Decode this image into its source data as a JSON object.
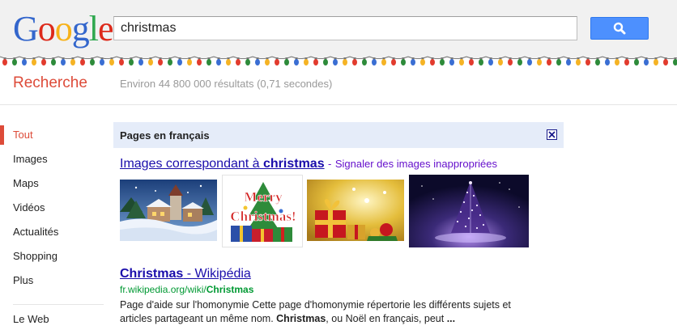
{
  "logo": {
    "letters": [
      "G",
      "o",
      "o",
      "g",
      "l",
      "e"
    ]
  },
  "search": {
    "query": "christmas"
  },
  "subheader": {
    "title": "Recherche",
    "stats": "Environ 44 800 000 résultats (0,71 secondes)"
  },
  "nav": {
    "items": [
      "Tout",
      "Images",
      "Maps",
      "Vidéos",
      "Actualités",
      "Shopping",
      "Plus"
    ],
    "web_label": "Le Web"
  },
  "lang_bar": {
    "title": "Pages en français"
  },
  "images": {
    "heading_prefix": "Images correspondant à ",
    "heading_query": "christmas",
    "report_link": "Signaler des images inappropriées"
  },
  "result": {
    "title_main": "Christmas",
    "title_suffix": " - Wikipédia",
    "url_prefix": "fr.wikipedia.org/wiki/",
    "url_bold": "Christmas",
    "snippet_line1": "Page d'aide sur l'homonymie Cette page d'homonymie répertorie les différents sujets et",
    "snippet_line2_a": "articles partageant un même nom. ",
    "snippet_line2_bold": "Christmas",
    "snippet_line2_b": ", ou Noël en français, peut ",
    "snippet_ellipsis": "..."
  },
  "thumb_texts": {
    "merry": "Merry",
    "christmas": "Christmas!"
  },
  "colors": {
    "accent_red": "#dd4b39",
    "link_blue": "#1a0dab",
    "url_green": "#009933",
    "button_blue": "#4d90fe",
    "lang_bar_bg": "#e5ecf9"
  }
}
